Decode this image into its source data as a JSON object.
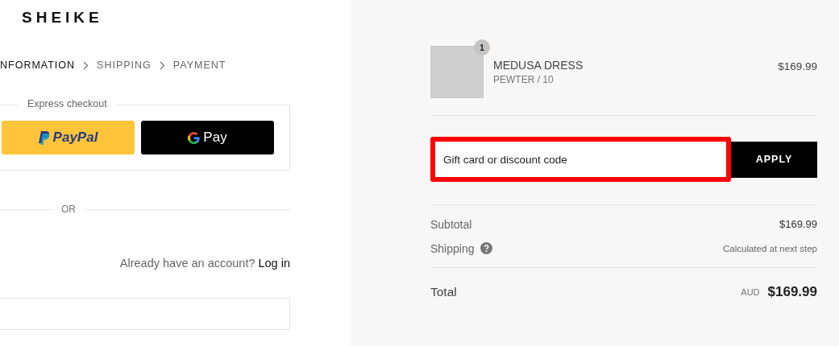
{
  "logo": "SHEIKE",
  "breadcrumb": [
    {
      "label": "NFORMATION",
      "selected": true
    },
    {
      "label": "SHIPPING",
      "selected": false
    },
    {
      "label": "PAYMENT",
      "selected": false
    }
  ],
  "express_checkout": {
    "title": "Express checkout",
    "buttons": [
      {
        "kind": "paypal",
        "label": "PayPal"
      },
      {
        "kind": "gpay",
        "label": "Pay"
      }
    ]
  },
  "divider_label": "OR",
  "account": {
    "text": "Already have an account?",
    "link": "Log in"
  },
  "order": {
    "items": [
      {
        "name": "MEDUSA DRESS",
        "variant": "PEWTER / 10",
        "price": "$169.99",
        "quantity": "1"
      }
    ],
    "discount": {
      "placeholder": "Gift card or discount code",
      "button": "APPLY",
      "highlighted": true
    },
    "subtotal": {
      "label": "Subtotal",
      "value": "$169.99"
    },
    "shipping": {
      "label": "Shipping",
      "value": "Calculated at next step"
    },
    "total": {
      "label": "Total",
      "currency": "AUD",
      "value": "$169.99"
    }
  }
}
